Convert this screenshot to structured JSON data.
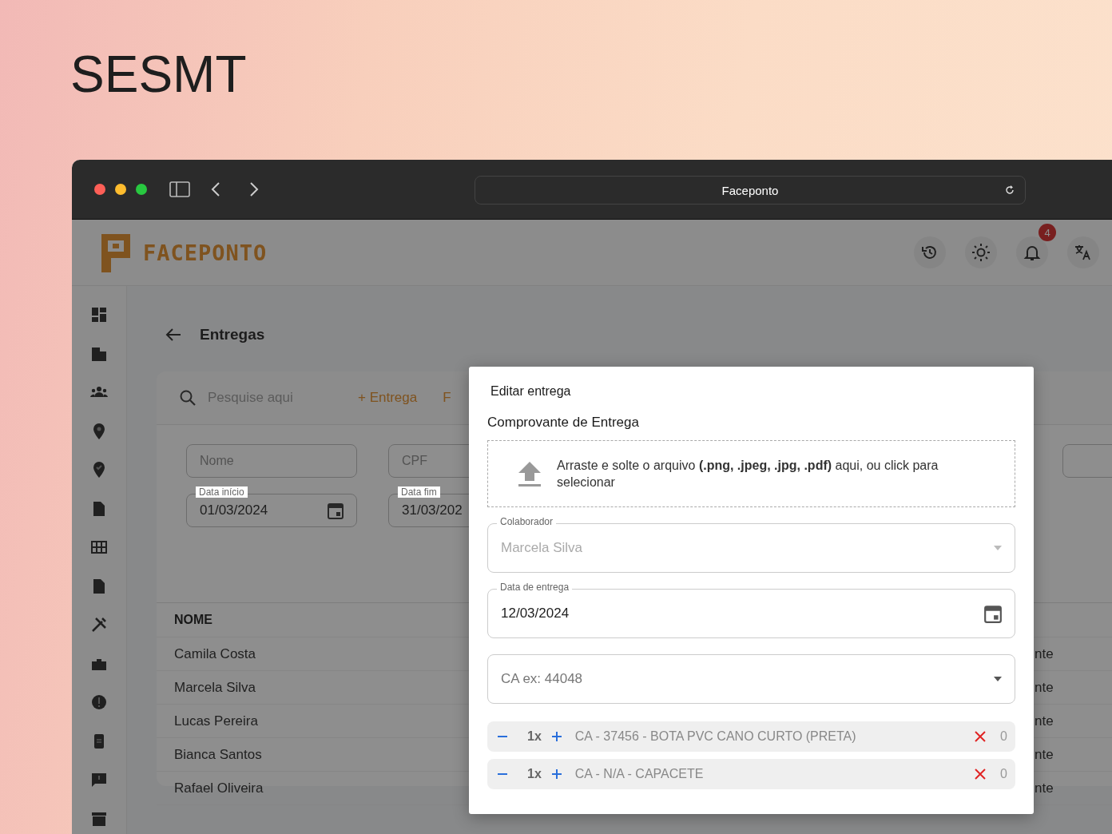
{
  "page_title": "SESMT",
  "browser": {
    "address": "Faceponto"
  },
  "app": {
    "brand": "FACEPONTO",
    "notifications_badge": "4"
  },
  "content": {
    "title": "Entregas",
    "search": {
      "placeholder": "Pesquise aqui"
    },
    "actions": [
      "+ Entrega",
      "F"
    ],
    "filters": {
      "name": {
        "placeholder": "Nome"
      },
      "cpf": {
        "placeholder": "CPF"
      },
      "start_date": {
        "label": "Data início",
        "value": "01/03/2024"
      },
      "end_date": {
        "label": "Data fim",
        "value": "31/03/202"
      }
    },
    "table": {
      "columns": [
        "NOME"
      ],
      "rows": [
        {
          "name": "Camila Costa",
          "column_2": "nte"
        },
        {
          "name": "Marcela Silva",
          "column_2": "nte"
        },
        {
          "name": "Lucas Pereira",
          "column_2": "nte"
        },
        {
          "name": "Bianca Santos",
          "column_2": "nte"
        },
        {
          "name": "Rafael Oliveira",
          "column_2": "nte"
        }
      ]
    }
  },
  "dialog": {
    "title": "Editar entrega",
    "section": "Comprovante de Entrega",
    "dropzone": "Arraste e solte o arquivo **(.png, .jpeg, .jpg, .pdf)** aqui, ou click para selecionar",
    "collaborator": {
      "label": "Colaborador",
      "value": "Marcela Silva",
      "disabled": true
    },
    "delivery_date": {
      "label": "Data de entrega",
      "value": "12/03/2024"
    },
    "ca_select": {
      "placeholder": "CA ex: 44048"
    },
    "items": [
      {
        "quantity": "1x",
        "label": "CA - 37456 - BOTA PVC CANO CURTO (PRETA)",
        "count": "0"
      },
      {
        "quantity": "1x",
        "label": "CA - N/A - CAPACETE",
        "count": "0"
      }
    ]
  }
}
